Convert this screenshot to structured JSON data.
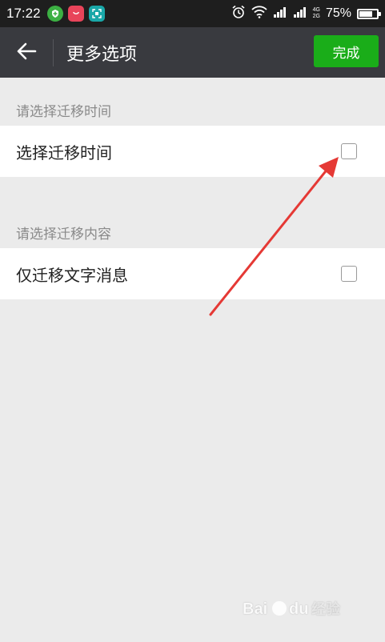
{
  "status_bar": {
    "time": "17:22",
    "network_top": "4G",
    "network_bottom": "2G",
    "battery_percent": "75%",
    "battery_level": 0.75
  },
  "header": {
    "title": "更多选项",
    "done_label": "完成"
  },
  "sections": [
    {
      "header": "请选择迁移时间",
      "option": {
        "label": "选择迁移时间",
        "checked": false
      }
    },
    {
      "header": "请选择迁移内容",
      "option": {
        "label": "仅迁移文字消息",
        "checked": false
      }
    }
  ],
  "colors": {
    "accent_green": "#1aad19",
    "title_bar": "#393a3f",
    "annotation_arrow": "#e53935"
  },
  "watermark": "Bai du 经验"
}
